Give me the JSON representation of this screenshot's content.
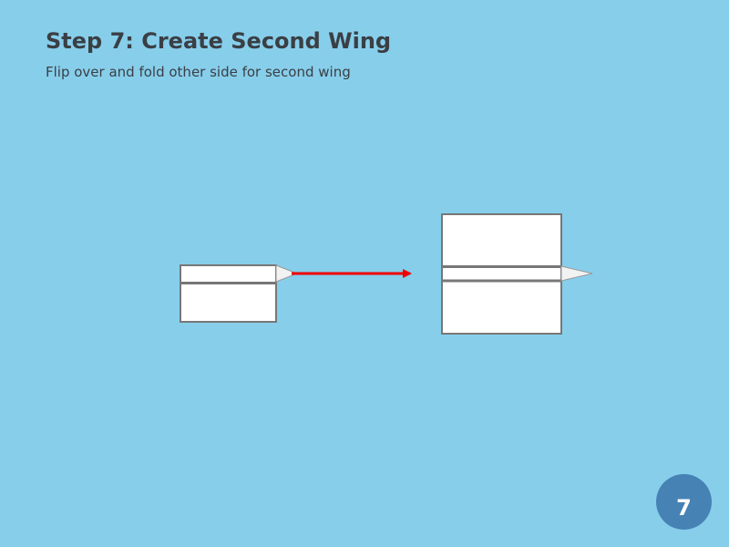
{
  "header": {
    "title": "Step 7: Create Second Wing",
    "instruction": "Flip over and fold other side for second wing"
  },
  "badge": {
    "step_number": "7"
  },
  "colors": {
    "background": "#87ceeb",
    "paper_fill": "#ffffff",
    "paper_edge": "#777777",
    "arrow": "#ee0000",
    "badge": "#4682b4",
    "title_text": "#3a3f44"
  }
}
